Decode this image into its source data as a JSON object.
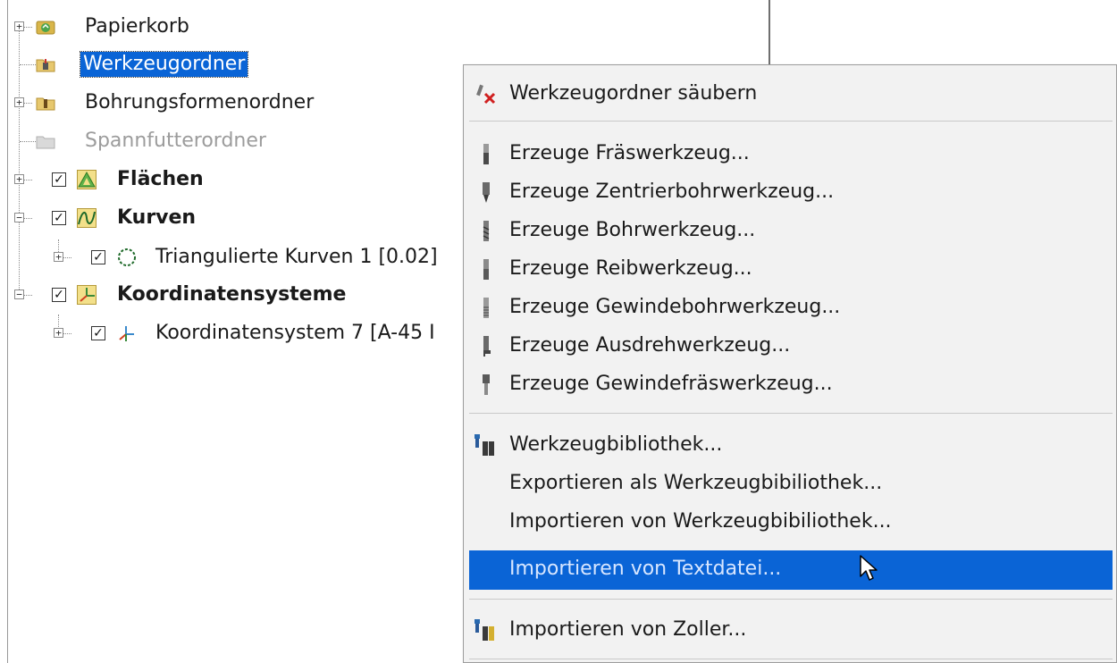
{
  "tree": {
    "items": [
      {
        "label": "Papierkorb",
        "icon": "recycle-bin-icon"
      },
      {
        "label": "Werkzeugordner",
        "icon": "tool-folder-icon"
      },
      {
        "label": "Bohrungsformenordner",
        "icon": "hole-shape-folder-icon"
      },
      {
        "label": "Spannfutterordner",
        "icon": "chuck-folder-icon"
      },
      {
        "label": "Flächen",
        "icon": "surfaces-icon",
        "checked": true
      },
      {
        "label": "Kurven",
        "icon": "curves-icon",
        "checked": true
      },
      {
        "label": "Triangulierte Kurven 1 [0.02]",
        "icon": "triangulated-curve-icon",
        "checked": true
      },
      {
        "label": "Koordinatensysteme",
        "icon": "coordinate-systems-icon",
        "checked": true
      },
      {
        "label": "Koordinatensystem 7 [A-45 I",
        "icon": "coordinate-system-icon",
        "checked": true
      }
    ]
  },
  "menu": {
    "items": [
      {
        "label": "Werkzeugordner säubern",
        "icon": "clean-tools-icon"
      },
      {
        "label": "Erzeuge Fräswerkzeug...",
        "icon": "milling-tool-icon"
      },
      {
        "label": "Erzeuge Zentrierbohrwerkzeug...",
        "icon": "center-drill-icon"
      },
      {
        "label": "Erzeuge Bohrwerkzeug...",
        "icon": "drill-tool-icon"
      },
      {
        "label": "Erzeuge Reibwerkzeug...",
        "icon": "reamer-tool-icon"
      },
      {
        "label": "Erzeuge Gewindebohrwerkzeug...",
        "icon": "tap-tool-icon"
      },
      {
        "label": "Erzeuge Ausdrehwerkzeug...",
        "icon": "boring-tool-icon"
      },
      {
        "label": "Erzeuge Gewindefräswerkzeug...",
        "icon": "thread-mill-icon"
      },
      {
        "label": "Werkzeugbibliothek...",
        "icon": "tool-library-icon"
      },
      {
        "label": "Exportieren als Werkzeugbibiliothek...",
        "icon": ""
      },
      {
        "label": "Importieren von Werkzeugbibiliothek...",
        "icon": ""
      },
      {
        "label": "Importieren von Textdatei...",
        "icon": "",
        "highlighted": true
      },
      {
        "label": "Importieren von Zoller...",
        "icon": "zoller-import-icon"
      }
    ]
  },
  "colors": {
    "selection": "#0a64d6",
    "menu_background": "#f2f2f2",
    "disabled_text": "#9c9c9c"
  }
}
